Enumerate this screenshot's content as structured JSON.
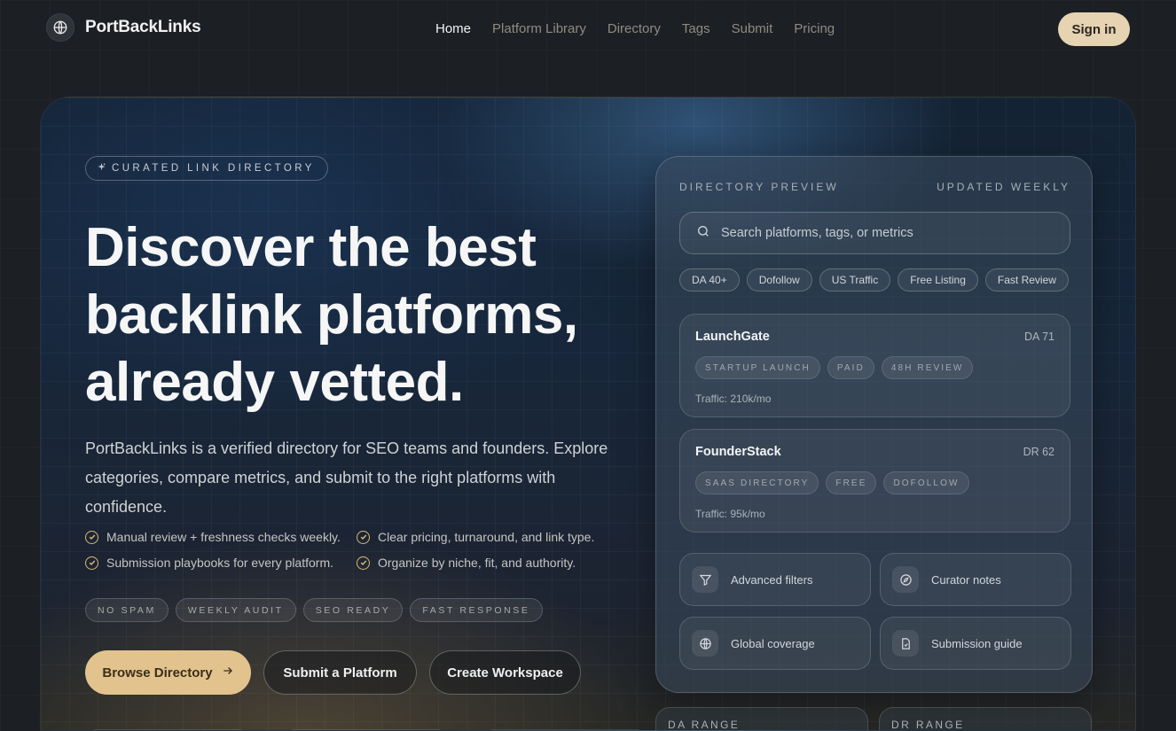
{
  "nav": {
    "brand": "PortBackLinks",
    "brand_icon": "globe-icon",
    "items": [
      {
        "label": "Home",
        "active": true
      },
      {
        "label": "Platform Library",
        "active": false
      },
      {
        "label": "Directory",
        "active": false
      },
      {
        "label": "Tags",
        "active": false
      },
      {
        "label": "Submit",
        "active": false
      },
      {
        "label": "Pricing",
        "active": false
      }
    ],
    "signin": "Sign in"
  },
  "hero": {
    "eyebrow": "CURATED LINK DIRECTORY",
    "eyebrow_icon": "sparkle-icon",
    "headline_lines": [
      "Discover the best",
      "backlink platforms,",
      "already vetted."
    ],
    "description": "PortBackLinks is a verified directory for SEO teams and founders. Explore categories, compare metrics, and submit to the right platforms with confidence.",
    "checks": [
      "Manual review + freshness checks weekly.",
      "Clear pricing, turnaround, and link type.",
      "Submission playbooks for every platform.",
      "Organize by niche, fit, and authority."
    ],
    "badges": [
      "NO SPAM",
      "WEEKLY AUDIT",
      "SEO READY",
      "FAST RESPONSE"
    ],
    "cta_primary": "Browse Directory",
    "cta_primary_icon": "arrow-right-icon",
    "cta_secondary": "Submit a Platform",
    "cta_tertiary": "Create Workspace"
  },
  "preview": {
    "title": "DIRECTORY PREVIEW",
    "updated": "UPDATED WEEKLY",
    "search_placeholder": "Search platforms, tags, or metrics",
    "chips": [
      "DA 40+",
      "Dofollow",
      "US Traffic",
      "Free Listing",
      "Fast Review"
    ],
    "cards": [
      {
        "name": "LaunchGate",
        "metric": "DA 71",
        "tags": [
          "STARTUP LAUNCH",
          "PAID",
          "48H REVIEW"
        ],
        "traffic": "Traffic: 210k/mo"
      },
      {
        "name": "FounderStack",
        "metric": "DR 62",
        "tags": [
          "SAAS DIRECTORY",
          "FREE",
          "DOFOLLOW"
        ],
        "traffic": "Traffic: 95k/mo"
      }
    ],
    "features": [
      {
        "label": "Advanced filters",
        "icon": "filter-icon"
      },
      {
        "label": "Curator notes",
        "icon": "compass-icon"
      },
      {
        "label": "Global coverage",
        "icon": "globe-icon"
      },
      {
        "label": "Submission guide",
        "icon": "document-icon"
      }
    ],
    "ranges": [
      "DA RANGE",
      "DR RANGE"
    ]
  },
  "colors": {
    "background": "#1c1f24",
    "accent": "#e2c38e",
    "signin_bg": "#e6d3b2",
    "check_icon": "#d9b879"
  }
}
